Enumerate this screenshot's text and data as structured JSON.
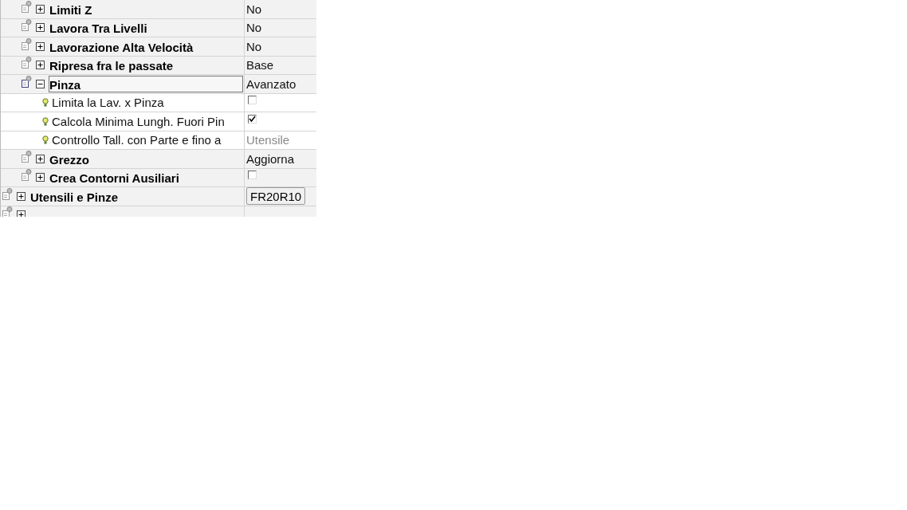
{
  "inner_items": [
    {
      "label": "Limiti Z",
      "expanded": false,
      "selected": false,
      "value": {
        "kind": "text",
        "text": "No"
      }
    },
    {
      "label": "Lavora Tra Livelli",
      "expanded": false,
      "selected": false,
      "value": {
        "kind": "text",
        "text": "No"
      }
    },
    {
      "label": "Lavorazione Alta Velocità",
      "expanded": false,
      "selected": false,
      "value": {
        "kind": "text",
        "text": "No"
      }
    },
    {
      "label": "Ripresa fra le passate",
      "expanded": false,
      "selected": false,
      "value": {
        "kind": "text",
        "text": "Base"
      }
    },
    {
      "label": "Pinza",
      "expanded": true,
      "selected": true,
      "value": {
        "kind": "text",
        "text": "Avanzato"
      },
      "children": [
        {
          "label": "Limita la Lav. x  Pinza",
          "value": {
            "kind": "checkbox",
            "checked": false
          }
        },
        {
          "label": "Calcola Minima Lungh. Fuori Pin",
          "value": {
            "kind": "checkbox",
            "checked": true
          }
        },
        {
          "label": "Controllo Tall. con Parte e fino a",
          "value": {
            "kind": "text",
            "text": "Utensile",
            "disabled": true
          }
        }
      ]
    },
    {
      "label": "Grezzo",
      "expanded": false,
      "selected": false,
      "value": {
        "kind": "text",
        "text": "Aggiorna"
      }
    },
    {
      "label": "Crea Contorni Ausiliari",
      "expanded": false,
      "selected": false,
      "value": {
        "kind": "checkbox",
        "checked": false
      }
    }
  ],
  "sections": [
    {
      "label": "Utensili e Pinze",
      "expanded": false,
      "selected": false,
      "value": {
        "kind": "button",
        "text": "FR20R10"
      }
    },
    {
      "expanded": false
    }
  ]
}
